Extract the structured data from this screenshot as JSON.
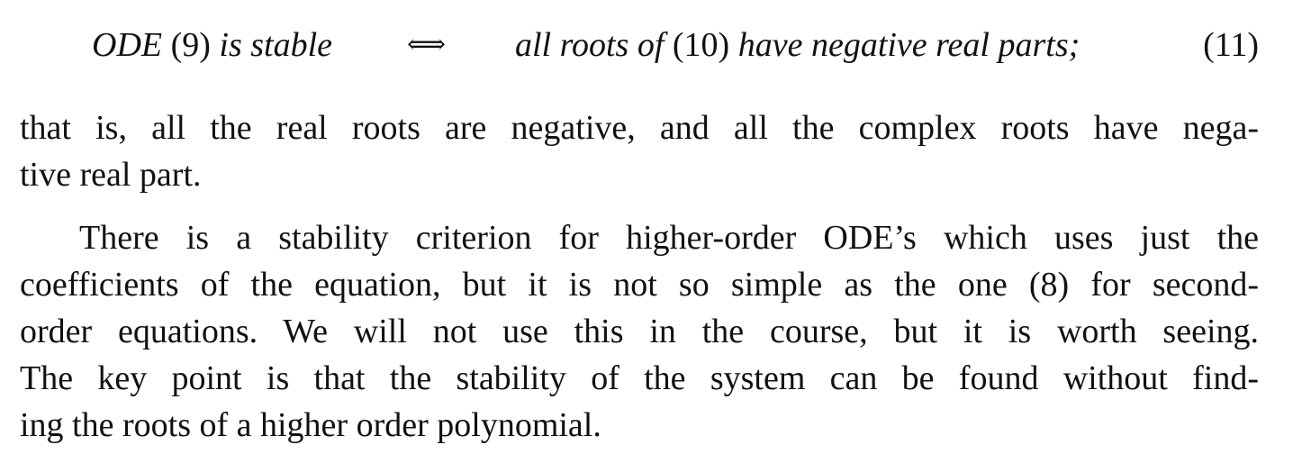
{
  "equation": {
    "left_subject": "ODE",
    "left_ref": "(9)",
    "left_predicate": "is stable",
    "operator": "⟺",
    "right_prefix": "all roots of",
    "right_ref": "(10)",
    "right_suffix": "have negative real parts;",
    "number": "(11)"
  },
  "paragraph1": {
    "lines": [
      "that is, all the real roots are negative, and all the complex roots have nega-",
      "tive real part."
    ]
  },
  "paragraph2": {
    "lines": [
      "There is a stability criterion for higher-order ODE’s which uses just the",
      "coefficients of the equation, but it is not so simple as the one (8) for second-",
      "order equations.  We will not use this in the course, but it is worth seeing.",
      "The key point is that the stability of the system can be found without find-",
      "ing the roots of a higher order polynomial."
    ]
  }
}
